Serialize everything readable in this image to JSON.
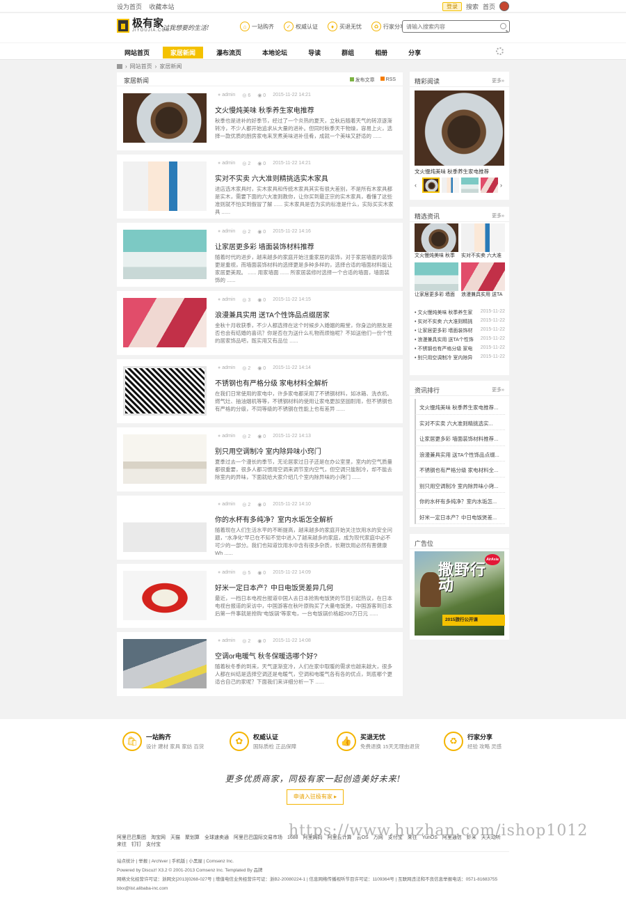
{
  "topbar": {
    "left_links": [
      "设为首页",
      "收藏本站"
    ],
    "login": "登录",
    "search_link": "搜索",
    "home_link": "首页"
  },
  "header": {
    "logo_text": "极有家",
    "logo_sub": "JIYOUJIA.COM",
    "slogan": "过我想要的生活!",
    "features": [
      "一站购齐",
      "权威认证",
      "买退无忧",
      "行家分享"
    ],
    "search_placeholder": "请输入搜索内容"
  },
  "nav": {
    "items": [
      "网站首页",
      "家居新闻",
      "瀑布流页",
      "本地论坛",
      "导读",
      "群组",
      "相册",
      "分享"
    ],
    "active_index": 1
  },
  "breadcrumb": [
    "网站首页",
    "家居新闻"
  ],
  "main": {
    "title": "家居新闻",
    "post_label": "发布文章",
    "rss_label": "RSS",
    "articles": [
      {
        "author": "admin",
        "views": "6",
        "comments": "0",
        "date": "2015-11-22 14:21",
        "title": "文火慢炖美味 秋季养生家电推荐",
        "excerpt": "秋季也是进补的好季节，经过了一个炎热的夏天，立秋后随着天气的转凉逐渐转冷，不少人都开始追求从大量的进补。但同时秋季天干物燥，容易上火，选择一款优质的厨房家电来烹煮美味进补佳肴，成就一个美味又舒适的 ......",
        "img": "img-food"
      },
      {
        "author": "admin",
        "views": "2",
        "comments": "0",
        "date": "2015-11-22 14:21",
        "title": "实对不实卖 六大准则精挑选实木家具",
        "excerpt": "进店选木家具时，实木家具和传统木家具其实有很大差别，不是所有木家具都是实木，需要下面的六大准则教你，让你买到最正宗的实木家具，看懂了这些准则就不怕买到假冒了解 ...... 实木家具是否为实的标准是什么，实际买实木家具 ......",
        "img": "img-shop"
      },
      {
        "author": "admin",
        "views": "2",
        "comments": "0",
        "date": "2015-11-22 14:16",
        "title": "让家居更多彩 墙面装饰材料推荐",
        "excerpt": "随着时代的进步，越来越多的家庭开始注重家居的装饰，对于家居墙面的装饰更是重视，而墙面装饰材料的选择更是多种多样的，选择合适的墙面材料能让家居更美观。 ...... 用家墙面 ...... 所家居装修时选择一个合适的墙面，墙面装饰的 ......",
        "img": "img-bed"
      },
      {
        "author": "admin",
        "views": "3",
        "comments": "0",
        "date": "2015-11-22 14:15",
        "title": "浪漫兼具实用 送TA个性饰品点缀居家",
        "excerpt": "金秋十月收获季，不少人都选择在这个时候步入婚姻的殿堂，你身边的朋友是否也会有结婚的喜讯？你是否在为送什么礼物而烦恼呢？不如送他们一份个性的居家饰品吧，既实用又有品位 ......",
        "img": "img-gifts"
      },
      {
        "author": "admin",
        "views": "2",
        "comments": "0",
        "date": "2015-11-22 14:14",
        "title": "不锈钢也有严格分级 家电材料全解析",
        "excerpt": "在我们日常使用的家电中，许多家电都采用了不锈钢材料，如冰箱、洗衣机、燃气灶、抽油烟机等等，不锈钢材料的使用让家电更加坚固耐用，但不锈钢也有严格的分级，不同等级的不锈钢在性能上也有差异 ......",
        "img": "img-pattern"
      },
      {
        "author": "admin",
        "views": "2",
        "comments": "0",
        "date": "2015-11-22 14:13",
        "title": "别只用空调制冷 室内除异味小窍门",
        "excerpt": "夏季过去一个漫长的季节，无论居家过日子还是在办公室里，室内的空气质量都很重要，很多人都习惯用空调来调节室内空气，但空调只能制冷，却不能去除室内的异味，下面就给大家介绍几个室内除异味的小窍门 ......",
        "img": "img-room"
      },
      {
        "author": "admin",
        "views": "2",
        "comments": "0",
        "date": "2015-11-22 14:10",
        "title": "你的水杯有多纯净？室内水垢怎全解析",
        "excerpt": "随着现在人们生活水平的不断提高，越来越多的家庭开始关注饮用水的安全问题，“水净化”早已在不知不觉中进入了越来越多的家庭，成为现代家庭中必不可少的一部分。我们也知道饮用水中含有很多杂质，长期饮用必然有害健康 Wh ......",
        "img": "img-filter"
      },
      {
        "author": "admin",
        "views": "5",
        "comments": "0",
        "date": "2015-11-22 14:09",
        "title": "好米一定日本产？中日电饭煲差异几何",
        "excerpt": "最近，一档日本电视台报道中国人去日本抢购电饭煲的节目引起热议，在日本电视台报道的采访中，中国游客在秋叶原购买了大量电饭煲，中国游客到日本后第一件事就是抢购“电饭锅”等家电，一台电饭锅价格超200万日元 ......",
        "img": "img-rice"
      },
      {
        "author": "admin",
        "views": "2",
        "comments": "0",
        "date": "2015-11-22 14:08",
        "title": "空调or电暖气 秋冬保暖选哪个好?",
        "excerpt": "随着秋冬季的到来，天气逐渐变冷，人们在家中取暖的需求也越来越大，很多人都在纠结是选择空调还是电暖气，空调和电暖气各有各的优点，到底哪个更适合自己的家呢？下面我们来详细分析一下 ......",
        "img": "img-laptop"
      }
    ]
  },
  "side_featured": {
    "title": "精彩阅读",
    "more": "更多»",
    "caption": "文火慢炖美味 秋季养生家电推荐"
  },
  "side_picks": {
    "title": "精选资讯",
    "more": "更多»",
    "grid": [
      {
        "cap": "文火慢炖美味 秋季",
        "img": "img-food"
      },
      {
        "cap": "实对不实卖 六大准",
        "img": "img-shop"
      },
      {
        "cap": "让家居更多彩 墙面",
        "img": "img-bed"
      },
      {
        "cap": "浪漫兼具实用 送TA",
        "img": "img-gifts"
      }
    ],
    "list": [
      {
        "title": "文火慢炖美味 秋季养生家",
        "date": "2015-11-22"
      },
      {
        "title": "实对不实卖 六大准则精挑",
        "date": "2015-11-22"
      },
      {
        "title": "让家居更多彩 墙面装饰材",
        "date": "2015-11-22"
      },
      {
        "title": "浪漫兼具实用 送TA个性饰",
        "date": "2015-11-22"
      },
      {
        "title": "不锈钢也有严格分级 家电",
        "date": "2015-11-22"
      },
      {
        "title": "别只用空调制冷 室内除异",
        "date": "2015-11-22"
      }
    ]
  },
  "side_rank": {
    "title": "资讯排行",
    "more": "更多»",
    "items": [
      "文火慢炖美味 秋季养生家电推荐...",
      "实对不实卖 六大准则精挑选实...",
      "让家居更多彩 墙面装饰材料推荐...",
      "浪漫兼具实用 送TA个性饰品点缀...",
      "不锈钢也有严格分级 家电材料全...",
      "别只用空调制冷 室内除异味小窍...",
      "你的水杯有多纯净？室内水垢怎...",
      "好米一定日本产？中日电饭煲差..."
    ]
  },
  "side_ad": {
    "title": "广告位",
    "brand": "AirAsia",
    "calligraphy": "撒野行动",
    "banner": "2015旅行公开课"
  },
  "footer": {
    "badges": [
      {
        "title": "一站购齐",
        "sub": "设计 建材 家具 家纺 百货",
        "icon": "🛍"
      },
      {
        "title": "权威认证",
        "sub": "国际质检 正品保障",
        "icon": "✿"
      },
      {
        "title": "买退无忧",
        "sub": "免费退换 15天无理由退货",
        "icon": "👍"
      },
      {
        "title": "行家分享",
        "sub": "经验 攻略 灵感",
        "icon": "♻"
      }
    ],
    "motto": "更多优质商家，同极有家一起创造美好未来!",
    "apply": "申请入驻极有家 ▸",
    "links": [
      "阿里巴巴集团",
      "淘宝网",
      "天猫",
      "聚划算",
      "全球速卖通",
      "阿里巴巴国际交易市场",
      "1688",
      "阿里妈妈",
      "阿里云计算",
      "云OS",
      "万网",
      "支付宝",
      "来往",
      "YunOS",
      "阿里通信",
      "虾米",
      "天天动听",
      "来往",
      "钉钉",
      "支付宝"
    ],
    "bottom_line1": "站点统计 | 举报 | Archiver | 手机版 | 小黑屋 | Comsenz Inc.",
    "bottom_line2": "Powered by Discuz! X3.2 © 2001-2013 Comsenz Inc. Templated By 品牌",
    "bottom_line3": "网络文化经营许可证：浙网文[2013]0268-027号 | 增值电信业务经营许可证：浙B2-20080224-1 | 信息网络传播视听节目许可证：1109364号 | 互联网违法和不良信息举报电话：0571-81683755 blxx@list.alibaba-inc.com"
  },
  "watermark": "https://www.huzhan.com/ishop1012"
}
